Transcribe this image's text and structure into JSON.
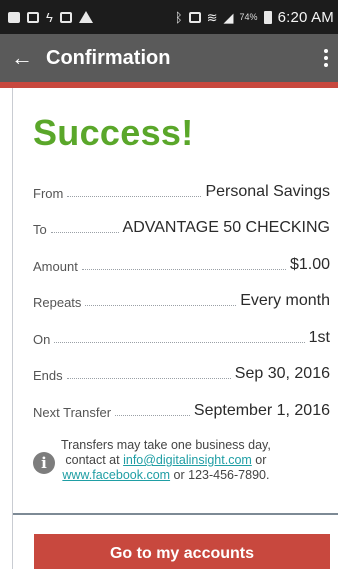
{
  "status_bar": {
    "battery_percent": "74%",
    "time": "6:20 AM",
    "icons": [
      "message-icon",
      "image-icon",
      "flash-icon",
      "gallery-icon",
      "warning-icon",
      "bluetooth-icon",
      "nfc-icon",
      "wifi-icon",
      "signal-icon",
      "battery-icon"
    ]
  },
  "app_bar": {
    "title": "Confirmation",
    "back_icon": "arrow-left-icon",
    "menu_icon": "more-vert-icon",
    "back_glyph": "←"
  },
  "colors": {
    "accent": "#c8483e",
    "success": "#5aa72a",
    "appbar": "#5a5a5a",
    "link": "#1f9ea4"
  },
  "main": {
    "heading": "Success!",
    "details": [
      {
        "label": "From",
        "value": "Personal Savings"
      },
      {
        "label": "To",
        "value": "ADVANTAGE 50 CHECKING"
      },
      {
        "label": "Amount",
        "value": "$1.00"
      },
      {
        "label": "Repeats",
        "value": "Every month"
      },
      {
        "label": "On",
        "value": "1st"
      },
      {
        "label": "Ends",
        "value": "Sep 30, 2016"
      },
      {
        "label": "Next Transfer",
        "value": "September 1, 2016"
      }
    ],
    "notice": {
      "icon": "info-icon",
      "icon_glyph": "i",
      "line1": "Transfers may take one business day,",
      "line2_prefix": "contact at ",
      "email": "info@digitalinsight.com",
      "line2_suffix": " or",
      "website": "www.facebook.com",
      "line3_suffix": " or 123-456-7890."
    },
    "button_label": "Go to my accounts"
  }
}
